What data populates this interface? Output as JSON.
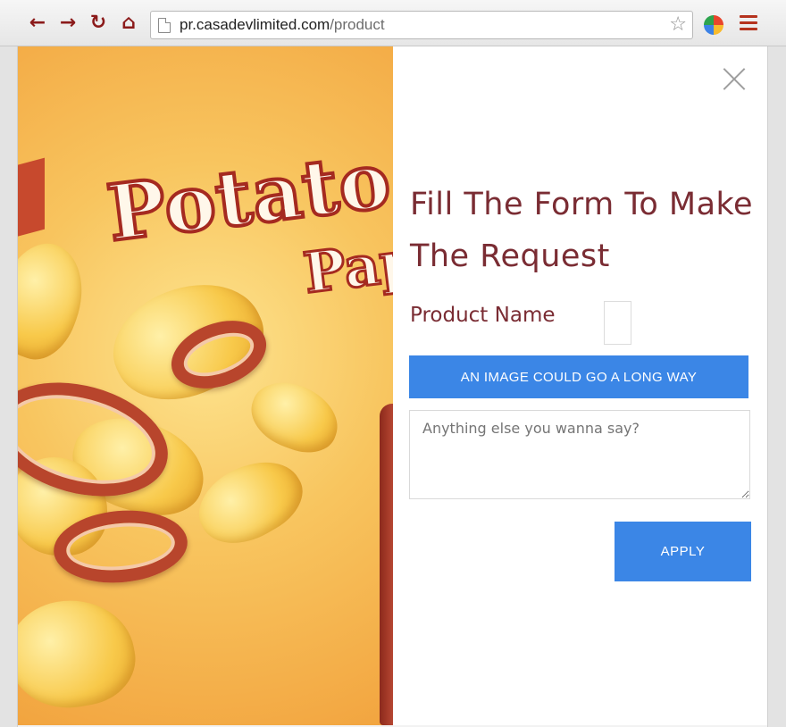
{
  "browser": {
    "url_host": "pr.casadevlimited.com",
    "url_path": "/product",
    "back_icon": "arrow-left",
    "forward_icon": "arrow-right",
    "reload_icon": "reload",
    "home_icon": "home",
    "accent": "#8b1a1a"
  },
  "promo": {
    "headline_line1": "Potato",
    "headline_line2": "Pap"
  },
  "form": {
    "title": "Fill The Form To Make The Request",
    "product_label": "Product Name",
    "product_value": "",
    "image_button": "AN IMAGE COULD GO A LONG WAY",
    "message_placeholder": "Anything else you wanna say?",
    "apply_button": "APPLY",
    "title_color": "#7a2c33",
    "button_color": "#3b86e6"
  }
}
